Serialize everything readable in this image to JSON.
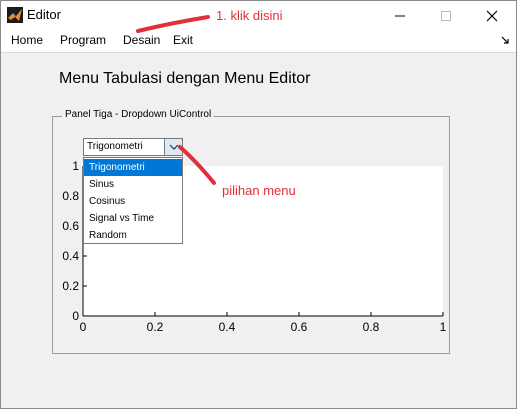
{
  "window": {
    "title": "Editor",
    "icon": "matlab-logo-icon"
  },
  "menubar": {
    "items": [
      "Home",
      "Program",
      "Desain",
      "Exit"
    ]
  },
  "main": {
    "heading": "Menu Tabulasi dengan Menu Editor",
    "panel_title": "Panel Tiga - Dropdown UiControl"
  },
  "dropdown": {
    "selected": "Trigonometri",
    "options": [
      "Trigonometri",
      "Sinus",
      "Cosinus",
      "Signal vs Time",
      "Random"
    ]
  },
  "annotations": {
    "step1": "1. klik disini",
    "menu_hint": "pilihan menu",
    "color": "#e0303a"
  },
  "chart_data": {
    "type": "line",
    "x": [],
    "series": [],
    "xlim": [
      0,
      1
    ],
    "ylim": [
      0,
      1
    ],
    "xticks": [
      "0",
      "0.2",
      "0.4",
      "0.6",
      "0.8",
      "1"
    ],
    "yticks": [
      "0",
      "0.2",
      "0.4",
      "0.6",
      "0.8",
      "1"
    ],
    "title": "",
    "xlabel": "",
    "ylabel": ""
  }
}
